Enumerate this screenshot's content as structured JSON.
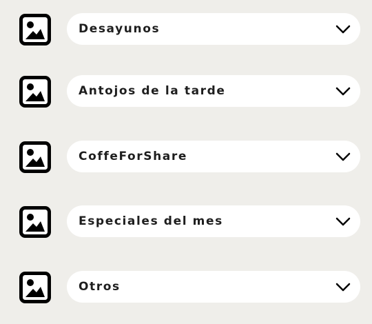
{
  "categories": [
    {
      "label": "Desayunos",
      "icon": "image-placeholder-icon",
      "control": "chevron-down-icon"
    },
    {
      "label": "Antojos de la tarde",
      "icon": "image-placeholder-icon",
      "control": "chevron-down-icon"
    },
    {
      "label": "CoffeForShare",
      "icon": "image-placeholder-icon",
      "control": "chevron-down-icon"
    },
    {
      "label": "Especiales del mes",
      "icon": "image-placeholder-icon",
      "control": "chevron-down-icon"
    },
    {
      "label": "Otros",
      "icon": "image-placeholder-icon",
      "control": "chevron-down-icon"
    }
  ],
  "colors": {
    "background": "#efeeea",
    "dropdown": "#ffffff",
    "text": "#1e1e1e",
    "icon": "#000000"
  }
}
